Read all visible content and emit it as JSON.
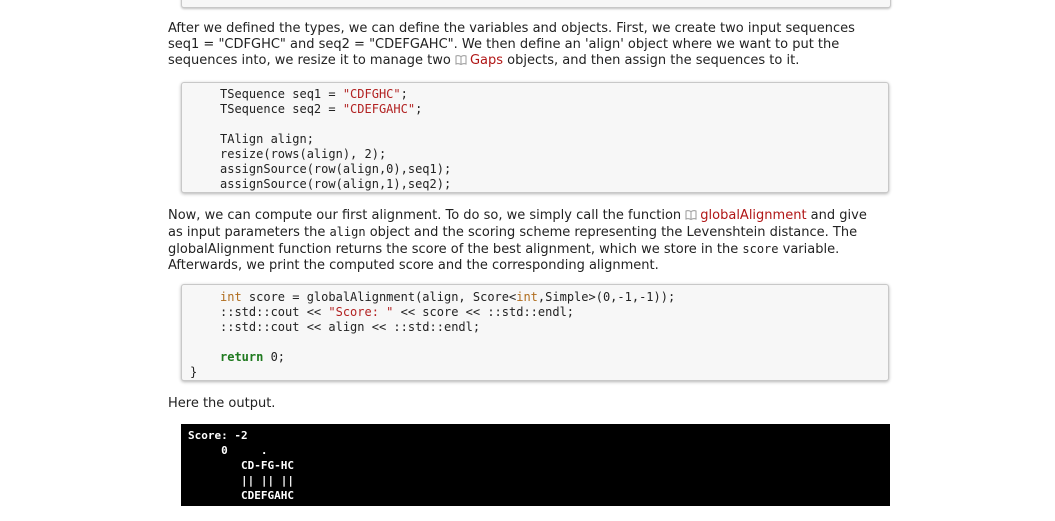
{
  "para1": {
    "t1": "After we defined the types, we can define the variables and objects. First, we create two input sequences",
    "t2": "seq1 = \"CDFGHC\" and seq2 = \"CDEFGAHC\". We then define an 'align' object where we want to put the",
    "t3a": "sequences into, we resize it to manage two ",
    "link": "Gaps",
    "t3b": " objects, and then assign the sequences to it."
  },
  "code1": {
    "l1a": "TSequence seq1 = ",
    "l1b": "\"CDFGHC\"",
    "l1c": ";",
    "l2a": "TSequence seq2 = ",
    "l2b": "\"CDEFGAHC\"",
    "l2c": ";",
    "l3": "TAlign align;",
    "l4": "resize(rows(align), 2);",
    "l5": "assignSource(row(align,0),seq1);",
    "l6": "assignSource(row(align,1),seq2);"
  },
  "para2": {
    "t1a": "Now, we can compute our first alignment. To do so, we simply call the function ",
    "link": "globalAlignment",
    "t1b": " and give",
    "t2a": "as input parameters the ",
    "t2code": "align",
    "t2b": " object and the scoring scheme representing the Levenshtein distance. The",
    "t3a": "globalAlignment function returns the score of the best alignment, which we store in the ",
    "t3code": "score",
    "t3b": " variable.",
    "t4": "Afterwards, we print the computed score and the corresponding alignment."
  },
  "code2": {
    "l1a": "int",
    "l1b": " score = globalAlignment(align, Score<",
    "l1c": "int",
    "l1d": ",Simple>(0,-1,-1));",
    "l2a": "::std::cout << ",
    "l2b": "\"Score: \"",
    "l2c": " << score << ::std::endl;",
    "l3": "::std::cout << align << ::std::endl;",
    "l4a": "return",
    "l4b": " 0;"
  },
  "closing_brace": "}",
  "para3": "Here the output.",
  "console": {
    "l1": "Score: -2",
    "l2": "     0     .",
    "l3": "        CD-FG-HC",
    "l4": "        || || ||",
    "l5": "        CDEFGAHC"
  }
}
